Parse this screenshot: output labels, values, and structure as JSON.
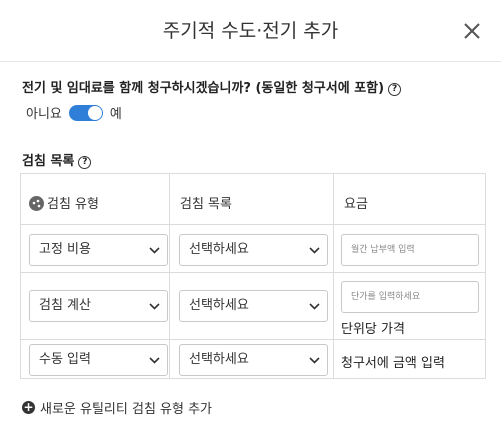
{
  "dialog": {
    "title": "주기적 수도·전기 추가"
  },
  "question": {
    "text": "전기 및 임대료를 함께 청구하시겠습니까? (동일한 청구서에 포함)",
    "help": "?"
  },
  "toggle": {
    "off_label": "아니요",
    "on_label": "예",
    "enabled": true
  },
  "section": {
    "title": "검침 목록",
    "help": "?"
  },
  "table": {
    "headers": [
      "검침 유형",
      "검침 목록",
      "요금"
    ],
    "rows": [
      {
        "type": "고정 비용",
        "item": "선택하세요",
        "fee_placeholder": "월간 납부액 입력",
        "note": ""
      },
      {
        "type": "검침 계산",
        "item": "선택하세요",
        "fee_placeholder": "단가를 입력하세요",
        "note": "단위당 가격"
      },
      {
        "type": "수동 입력",
        "item": "선택하세요",
        "fee_placeholder": "",
        "note": "청구서에 금액 입력"
      }
    ]
  },
  "add_button": {
    "label": "새로운 유틸리티 검침 유형 추가"
  },
  "colors": {
    "accent": "#2f7fd8",
    "border": "#dcdcdc"
  }
}
